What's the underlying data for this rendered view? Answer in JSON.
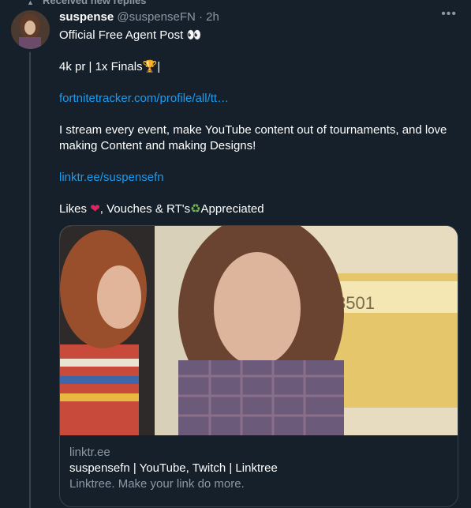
{
  "banner": "Received new replies",
  "tweet": {
    "display_name": "suspense",
    "handle": "@suspenseFN",
    "separator": "·",
    "time": "2h",
    "lines": {
      "l1": "Official Free Agent Post",
      "l1_emoji": "👀",
      "l2": "4k pr | 1x Finals",
      "l2_emoji": "🏆",
      "l2_end": "|",
      "l3_link": "fortnitetracker.com/profile/all/tt…",
      "l4": "I stream every event, make YouTube content out of tournaments, and love making Content and making Designs!",
      "l5_link": "linktr.ee/suspensefn",
      "l6_a": "Likes",
      "l6_heart": "❤",
      "l6_b": ", Vouches & RT's",
      "l6_recycle": "♻",
      "l6_c": "Appreciated"
    }
  },
  "card": {
    "domain": "linktr.ee",
    "title": "suspensefn | YouTube, Twitch | Linktree",
    "description": "Linktree. Make your link do more.",
    "image_text": "3501"
  },
  "icons": {
    "more": "more-icon",
    "avatar": "avatar-image"
  },
  "colors": {
    "background": "#15202b",
    "link": "#1d9bf0",
    "muted": "#8b98a5",
    "border": "#38444d"
  }
}
